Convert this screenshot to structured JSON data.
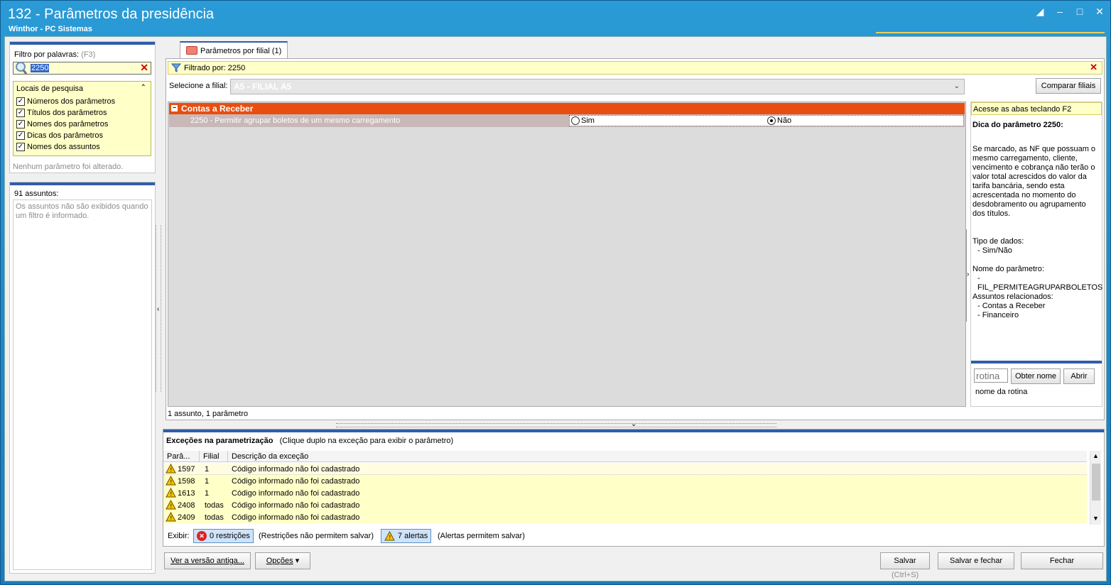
{
  "window": {
    "title": "132 - Parâmetros da presidência",
    "subtitle": "Winthor - PC Sistemas"
  },
  "filter": {
    "label": "Filtro por palavras:",
    "shortcut": "(F3)",
    "value": "2250",
    "locais_title": "Locais de pesquisa",
    "locais": [
      {
        "label": "Números dos parâmetros",
        "checked": true
      },
      {
        "label": "Títulos dos parâmetros",
        "checked": true
      },
      {
        "label": "Nomes dos parâmetros",
        "checked": true
      },
      {
        "label": "Dicas dos parâmetros",
        "checked": true
      },
      {
        "label": "Nomes dos assuntos",
        "checked": true
      }
    ],
    "no_change": "Nenhum parâmetro foi alterado."
  },
  "assuntos": {
    "count_label": "91 assuntos:",
    "note": "Os assuntos não são exibidos quando um filtro é informado."
  },
  "tab": {
    "label": "Parâmetros por filial",
    "count": "(1)"
  },
  "filtered": {
    "text": "Filtrado por: 2250"
  },
  "filial": {
    "label": "Selecione a filial:",
    "selected": "A5 - FILIAL A5",
    "compare_button": "Comparar filiais"
  },
  "grid": {
    "group": "Contas a Receber",
    "param_label": "2250 - Permitir agrupar boletos de um mesmo carregamento",
    "option_sim": "Sim",
    "option_nao": "Não",
    "selected": "Não",
    "summary": "1 assunto, 1 parâmetro"
  },
  "help": {
    "hint": "Acesse as abas teclando F2",
    "title": "Dica do parâmetro 2250:",
    "text": "Se marcado, as NF que possuam o mesmo carregamento, cliente, vencimento e cobrança não terão o valor total acrescidos do valor da tarifa bancária, sendo esta acrescentada no momento do desdobramento ou agrupamento dos títulos.",
    "tipo_label": "Tipo de dados:",
    "tipo_value": "- Sim/Não",
    "nome_label": "Nome do parâmetro:",
    "nome_value": "- FIL_PERMITEAGRUPARBOLETOS",
    "assuntos_label": "Assuntos relacionados:",
    "assuntos": [
      "- Contas a Receber",
      "- Financeiro"
    ],
    "rotina_placeholder": "rotina",
    "obter_button": "Obter nome",
    "abrir_button": "Abrir",
    "rotina_caption": "nome da rotina"
  },
  "exceptions": {
    "title": "Exceções na parametrização",
    "subtitle": "(Clique duplo na exceção para exibir o parâmetro)",
    "columns": [
      "Parâ...",
      "Filial",
      "Descrição da exceção"
    ],
    "rows": [
      {
        "param": "1597",
        "filial": "1",
        "desc": "Código informado não foi cadastrado"
      },
      {
        "param": "1598",
        "filial": "1",
        "desc": "Código informado não foi cadastrado"
      },
      {
        "param": "1613",
        "filial": "1",
        "desc": "Código informado não foi cadastrado"
      },
      {
        "param": "2408",
        "filial": "todas",
        "desc": "Código informado não foi cadastrado"
      },
      {
        "param": "2409",
        "filial": "todas",
        "desc": "Código informado não foi cadastrado"
      }
    ],
    "exibir_label": "Exibir:",
    "restricoes": "0 restrições",
    "restricoes_note": "(Restrições não permitem salvar)",
    "alertas": "7 alertas",
    "alertas_note": "(Alertas permitem salvar)"
  },
  "footer": {
    "old_version": "Ver a versão antiga...",
    "options": "Opções",
    "save": "Salvar",
    "save_shortcut": "(Ctrl+S)",
    "save_close": "Salvar e fechar",
    "close": "Fechar"
  },
  "colors": {
    "accent": "#2f5da8",
    "group": "#e84e10",
    "highlight": "#ffffc8"
  }
}
